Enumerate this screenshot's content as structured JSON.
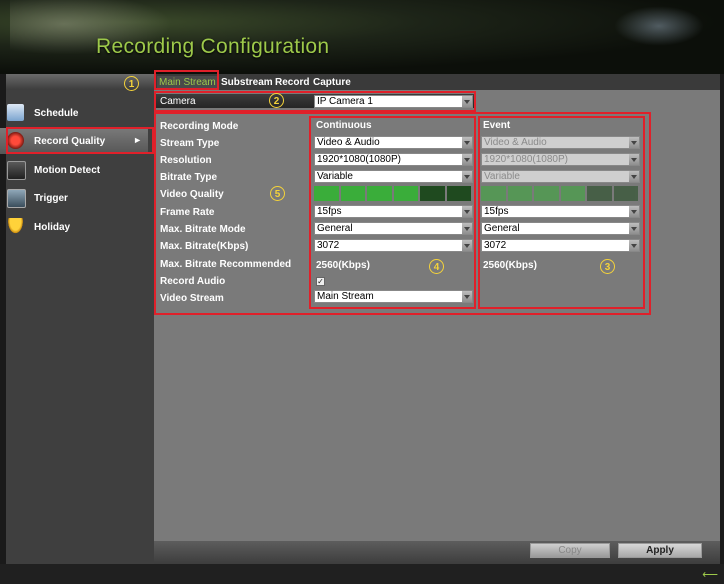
{
  "header": {
    "title": "Recording Configuration"
  },
  "tabs": [
    {
      "label": "Main Stream",
      "active": true
    },
    {
      "label": "Substream",
      "active": false
    },
    {
      "label": "Record",
      "active": false
    },
    {
      "label": "Capture",
      "active": false
    }
  ],
  "sidebar": {
    "items": [
      {
        "label": "Schedule",
        "icon": "calendar-icon",
        "active": false
      },
      {
        "label": "Record Quality",
        "icon": "record-icon",
        "active": true
      },
      {
        "label": "Motion Detect",
        "icon": "motion-icon",
        "active": false
      },
      {
        "label": "Trigger",
        "icon": "trigger-icon",
        "active": false
      },
      {
        "label": "Holiday",
        "icon": "umbrella-icon",
        "active": false
      }
    ]
  },
  "camera": {
    "label": "Camera",
    "value": "IP Camera 1"
  },
  "columns": {
    "continuous": "Continuous",
    "event": "Event"
  },
  "fields": {
    "recording_mode": "Recording Mode",
    "stream_type": "Stream Type",
    "resolution": "Resolution",
    "bitrate_type": "Bitrate Type",
    "video_quality": "Video Quality",
    "frame_rate": "Frame Rate",
    "max_bitrate_mode": "Max. Bitrate Mode",
    "max_bitrate": "Max. Bitrate(Kbps)",
    "max_bitrate_recommended": "Max. Bitrate Recommended",
    "record_audio": "Record Audio",
    "video_stream": "Video Stream"
  },
  "continuous": {
    "stream_type": "Video & Audio",
    "resolution": "1920*1080(1080P)",
    "bitrate_type": "Variable",
    "video_quality_level": 4,
    "video_quality_max": 6,
    "frame_rate": "15fps",
    "max_bitrate_mode": "General",
    "max_bitrate": "3072",
    "max_bitrate_recommended": "2560(Kbps)",
    "record_audio": true,
    "video_stream": "Main Stream"
  },
  "event": {
    "stream_type": "Video & Audio",
    "resolution": "1920*1080(1080P)",
    "bitrate_type": "Variable",
    "video_quality_level": 4,
    "video_quality_max": 6,
    "frame_rate": "15fps",
    "max_bitrate_mode": "General",
    "max_bitrate": "3072",
    "max_bitrate_recommended": "2560(Kbps)"
  },
  "badges": [
    "1",
    "2",
    "3",
    "4",
    "5"
  ],
  "buttons": {
    "copy": "Copy",
    "apply": "Apply"
  },
  "colors": {
    "accent": "#9dc94a",
    "highlight": "#e0202a",
    "badge": "#f5d33a",
    "quality_on": "#3aad3a",
    "quality_off": "#1f4a1f"
  }
}
